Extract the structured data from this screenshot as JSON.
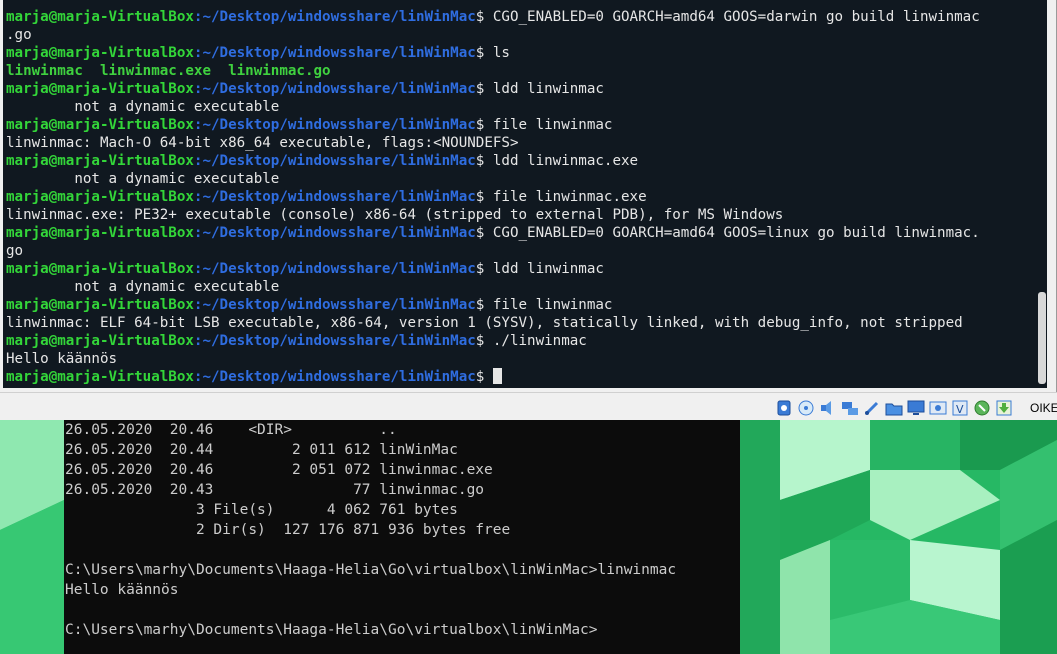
{
  "terminal": {
    "prompt_user": "marja@marja-VirtualBox",
    "prompt_path": ":~/Desktop/windowsshare/linWinMac",
    "lines": [
      {
        "type": "prompt",
        "cmd": " CGO_ENABLED=0 GOARCH=amd64 GOOS=darwin go build linwinmac"
      },
      {
        "type": "output",
        "text": ".go"
      },
      {
        "type": "prompt",
        "cmd": " ls"
      },
      {
        "type": "ls",
        "text": "linwinmac  linwinmac.exe  linwinmac.go"
      },
      {
        "type": "prompt",
        "cmd": " ldd linwinmac"
      },
      {
        "type": "output",
        "text": "        not a dynamic executable"
      },
      {
        "type": "prompt",
        "cmd": " file linwinmac"
      },
      {
        "type": "output",
        "text": "linwinmac: Mach-O 64-bit x86_64 executable, flags:<NOUNDEFS>"
      },
      {
        "type": "prompt",
        "cmd": " ldd linwinmac.exe"
      },
      {
        "type": "output",
        "text": "        not a dynamic executable"
      },
      {
        "type": "prompt",
        "cmd": " file linwinmac.exe"
      },
      {
        "type": "output",
        "text": "linwinmac.exe: PE32+ executable (console) x86-64 (stripped to external PDB), for MS Windows"
      },
      {
        "type": "prompt",
        "cmd": " CGO_ENABLED=0 GOARCH=amd64 GOOS=linux go build linwinmac."
      },
      {
        "type": "output",
        "text": "go"
      },
      {
        "type": "prompt",
        "cmd": " ldd linwinmac"
      },
      {
        "type": "output",
        "text": "        not a dynamic executable"
      },
      {
        "type": "prompt",
        "cmd": " file linwinmac"
      },
      {
        "type": "output",
        "text": "linwinmac: ELF 64-bit LSB executable, x86-64, version 1 (SYSV), statically linked, with debug_info, not stripped"
      },
      {
        "type": "prompt",
        "cmd": " ./linwinmac"
      },
      {
        "type": "output",
        "text": "Hello käännös"
      },
      {
        "type": "prompt",
        "cmd": " ",
        "cursor": true
      }
    ]
  },
  "statusbar": {
    "icons": [
      "hard-disk-icon",
      "optical-drive-icon",
      "audio-icon",
      "network-icon",
      "usb-icon",
      "shared-folders-icon",
      "display-icon",
      "recording-icon",
      "virtualization-icon",
      "mouse-integration-icon",
      "arrow-down-icon"
    ],
    "host_key": "OIKE"
  },
  "cmd": {
    "lines": [
      "26.05.2020  20.46    <DIR>          ..",
      "26.05.2020  20.44         2 011 612 linWinMac",
      "26.05.2020  20.46         2 051 072 linwinmac.exe",
      "26.05.2020  20.43                77 linwinmac.go",
      "               3 File(s)      4 062 761 bytes",
      "               2 Dir(s)  127 176 871 936 bytes free",
      "",
      "C:\\Users\\marhy\\Documents\\Haaga-Helia\\Go\\virtualbox\\linWinMac>linwinmac",
      "Hello käännös",
      "",
      "C:\\Users\\marhy\\Documents\\Haaga-Helia\\Go\\virtualbox\\linWinMac>"
    ]
  },
  "colors": {
    "terminal_bg": "#101820",
    "user_green": "#33d639",
    "path_blue": "#2f6de0",
    "cmd_bg": "#0c0c0c",
    "desktop_green": "#25b862"
  }
}
